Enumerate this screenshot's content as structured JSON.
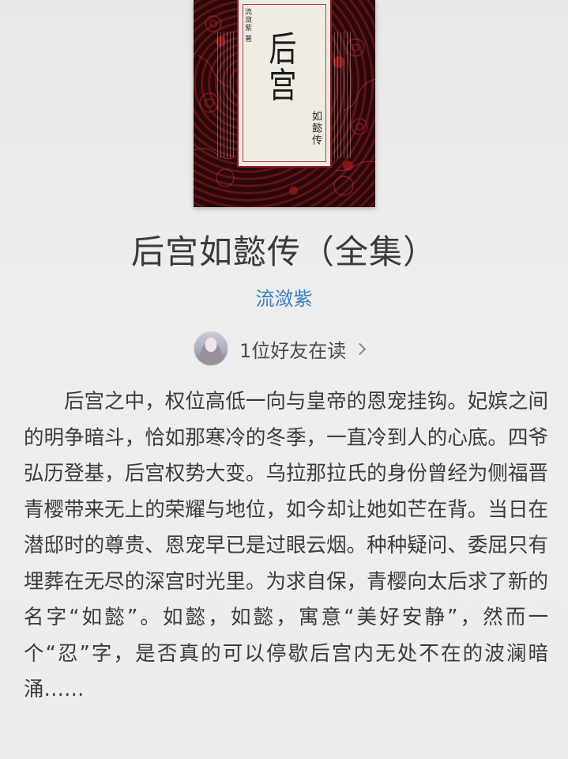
{
  "book": {
    "cover": {
      "author_small": "流潋紫 著",
      "big_title": "后宫",
      "sub_title": "如懿传"
    },
    "title": "后宫如懿传（全集）",
    "author": "流潋紫",
    "friends_reading": "1位好友在读",
    "description": "后宫之中，权位高低一向与皇帝的恩宠挂钩。妃嫔之间的明争暗斗，恰如那寒冷的冬季，一直冷到人的心底。四爷弘历登基，后宫权势大变。乌拉那拉氏的身份曾经为侧福晋青樱带来无上的荣耀与地位，如今却让她如芒在背。当日在潜邸时的尊贵、恩宠早已是过眼云烟。种种疑问、委屈只有埋葬在无尽的深宫时光里。为求自保，青樱向太后求了新的名字“如懿”。如懿，如懿，寓意“美好安静”，然而一个“忍”字，是否真的可以停歇后宫内无处不在的波澜暗涌……"
  },
  "colors": {
    "author_link": "#3a7fc2",
    "text": "#3c3c3c",
    "background": "#ececed",
    "cover_red": "#8a1a1f"
  },
  "icons": {
    "friend_avatar": "avatar",
    "more": "chevron-right-icon"
  }
}
